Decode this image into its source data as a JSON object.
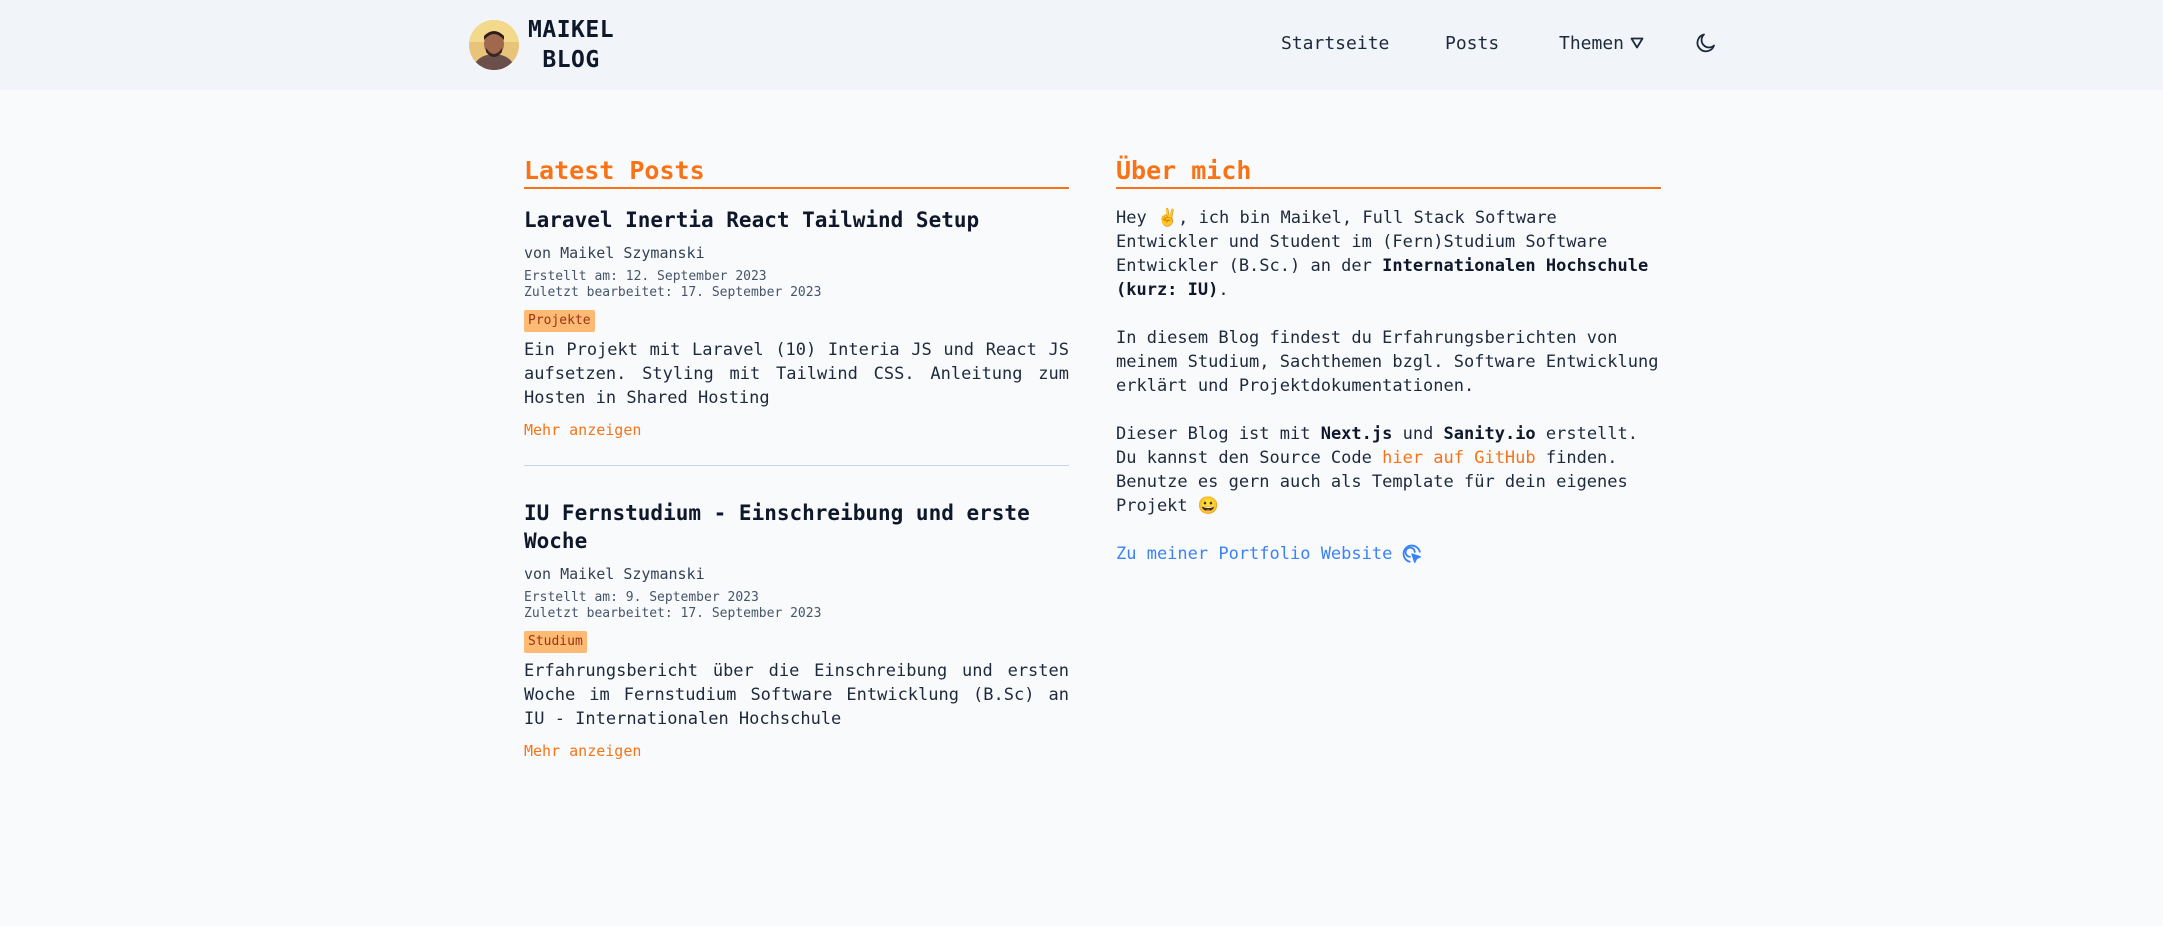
{
  "header": {
    "brand_line1": "MAIKEL",
    "brand_line2": "BLOG",
    "nav": [
      {
        "label": "Startseite"
      },
      {
        "label": "Posts"
      },
      {
        "label": "Themen"
      }
    ],
    "theme_toggle_icon": "moon-icon"
  },
  "latest": {
    "title": "Latest Posts",
    "posts": [
      {
        "title": "Laravel Inertia React Tailwind Setup",
        "author": "von Maikel Szymanski",
        "created": "Erstellt am: 12. September 2023",
        "edited": "Zuletzt bearbeitet: 17. September 2023",
        "tag": "Projekte",
        "excerpt": "Ein Projekt mit Laravel (10) Interia JS und React JS aufsetzen. Styling mit Tailwind CSS. Anleitung zum Hosten in Shared Hosting",
        "more": "Mehr anzeigen"
      },
      {
        "title": "IU Fernstudium - Einschreibung und erste Woche",
        "author": "von Maikel Szymanski",
        "created": "Erstellt am: 9. September 2023",
        "edited": "Zuletzt bearbeitet: 17. September 2023",
        "tag": "Studium",
        "excerpt": "Erfahrungsbericht über die Einschreibung und ersten Woche im Fernstudium Software Entwicklung (B.Sc) an IU - Internationalen Hochschule",
        "more": "Mehr anzeigen"
      }
    ]
  },
  "about": {
    "title": "Über mich",
    "p1_a": "Hey ✌️, ich bin Maikel, Full Stack Software Entwickler und Student im (Fern)Studium Software Entwickler (B.Sc.) an der ",
    "p1_b": "Internationalen Hochschule (kurz: IU)",
    "p1_c": ".",
    "p2": "In diesem Blog findest du Erfahrungsberichten von meinem Studium, Sachthemen bzgl. Software Entwicklung erklärt und Projektdokumentationen.",
    "p3_a": "Dieser Blog ist mit ",
    "p3_b": "Next.js",
    "p3_c": " und ",
    "p3_d": "Sanity.io",
    "p3_e": " erstellt. Du kannst den Source Code ",
    "p3_link": "hier auf GitHub",
    "p3_f": " finden.",
    "p4": "Benutze es gern auch als Template für dein eigenes Projekt 😀",
    "portfolio": "Zu meiner Portfolio Website"
  },
  "colors": {
    "accent": "#f97316",
    "link": "#3b82f6",
    "tag_bg": "#fdba74"
  }
}
